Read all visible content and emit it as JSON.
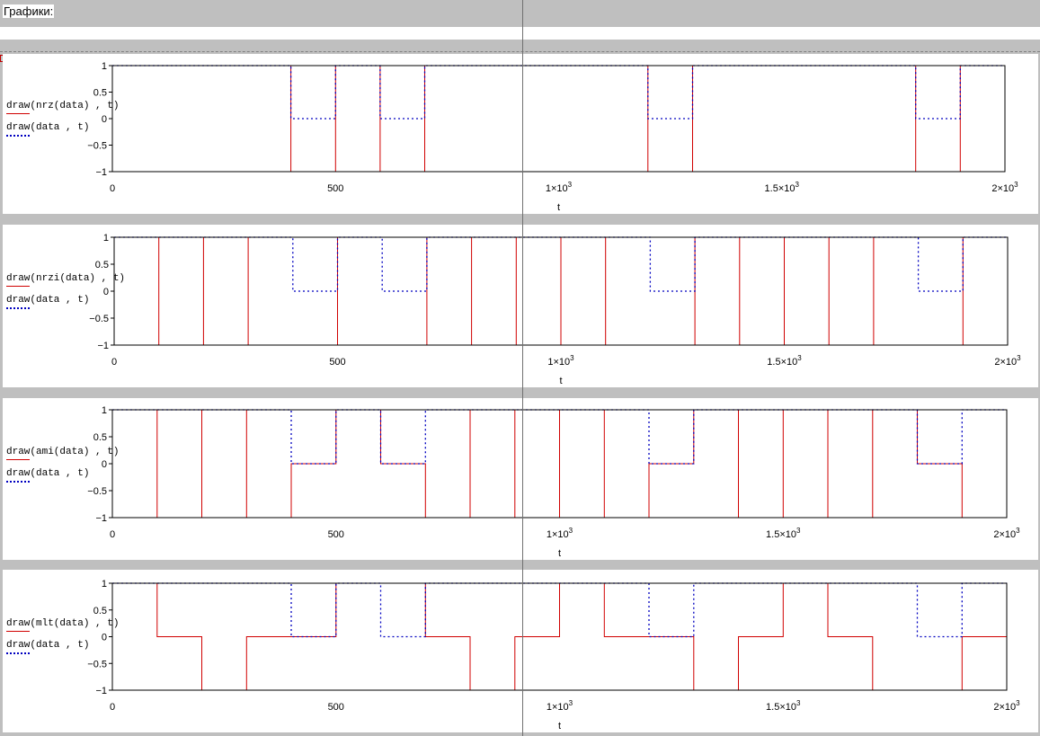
{
  "header": {
    "title": "Графики:"
  },
  "colors": {
    "series_solid": "#d00000",
    "series_dotted": "#0000c0",
    "frame": "#000000"
  },
  "chart_data": [
    {
      "type": "line",
      "xlabel": "t",
      "xlim": [
        0,
        2000
      ],
      "ylim": [
        -1,
        1
      ],
      "x_ticks": [
        "0",
        "500",
        "1×10^3",
        "1.5×10^3",
        "2×10^3"
      ],
      "y_ticks": [
        "1",
        "0.5",
        "0",
        "−0.5",
        "−1"
      ],
      "legend": [
        "draw(nrz(data) , t)",
        "draw(data , t)"
      ],
      "data_bits": [
        1,
        1,
        1,
        1,
        0,
        1,
        0,
        1,
        1,
        1,
        1,
        1,
        0,
        1,
        1,
        1,
        1,
        1,
        0,
        1
      ],
      "series": [
        {
          "name": "draw(nrz(data) , t)",
          "style": "solid",
          "levels": [
            1,
            1,
            1,
            1,
            -1,
            1,
            -1,
            1,
            1,
            1,
            1,
            1,
            -1,
            1,
            1,
            1,
            1,
            1,
            -1,
            1
          ]
        },
        {
          "name": "draw(data , t)",
          "style": "dotted",
          "levels": [
            1,
            1,
            1,
            1,
            0,
            1,
            0,
            1,
            1,
            1,
            1,
            1,
            0,
            1,
            1,
            1,
            1,
            1,
            0,
            1
          ]
        }
      ]
    },
    {
      "type": "line",
      "xlabel": "t",
      "xlim": [
        0,
        2000
      ],
      "ylim": [
        -1,
        1
      ],
      "x_ticks": [
        "0",
        "500",
        "1×10^3",
        "1.5×10^3",
        "2×10^3"
      ],
      "y_ticks": [
        "1",
        "0.5",
        "0",
        "−0.5",
        "−1"
      ],
      "legend": [
        "draw(nrzi(data) , t)",
        "draw(data , t)"
      ],
      "data_bits": [
        1,
        1,
        1,
        1,
        0,
        1,
        0,
        1,
        1,
        1,
        1,
        1,
        0,
        1,
        1,
        1,
        1,
        1,
        0,
        1
      ],
      "series": [
        {
          "name": "draw(nrzi(data) , t)",
          "style": "solid",
          "levels": [
            1,
            -1,
            1,
            -1,
            -1,
            1,
            1,
            -1,
            1,
            -1,
            1,
            -1,
            -1,
            1,
            -1,
            1,
            -1,
            1,
            1,
            -1
          ]
        },
        {
          "name": "draw(data , t)",
          "style": "dotted",
          "levels": [
            1,
            1,
            1,
            1,
            0,
            1,
            0,
            1,
            1,
            1,
            1,
            1,
            0,
            1,
            1,
            1,
            1,
            1,
            0,
            1
          ]
        }
      ]
    },
    {
      "type": "line",
      "xlabel": "t",
      "xlim": [
        0,
        2000
      ],
      "ylim": [
        -1,
        1
      ],
      "x_ticks": [
        "0",
        "500",
        "1×10^3",
        "1.5×10^3",
        "2×10^3"
      ],
      "y_ticks": [
        "1",
        "0.5",
        "0",
        "−0.5",
        "−1"
      ],
      "legend": [
        "draw(ami(data) , t)",
        "draw(data , t)"
      ],
      "data_bits": [
        1,
        1,
        1,
        1,
        0,
        1,
        0,
        1,
        1,
        1,
        1,
        1,
        0,
        1,
        1,
        1,
        1,
        1,
        0,
        1
      ],
      "series": [
        {
          "name": "draw(ami(data) , t)",
          "style": "solid",
          "levels": [
            1,
            -1,
            1,
            -1,
            0,
            1,
            0,
            -1,
            1,
            -1,
            1,
            -1,
            0,
            1,
            -1,
            1,
            -1,
            1,
            0,
            -1
          ]
        },
        {
          "name": "draw(data , t)",
          "style": "dotted",
          "levels": [
            1,
            1,
            1,
            1,
            0,
            1,
            0,
            1,
            1,
            1,
            1,
            1,
            0,
            1,
            1,
            1,
            1,
            1,
            0,
            1
          ]
        }
      ]
    },
    {
      "type": "line",
      "xlabel": "t",
      "xlim": [
        0,
        2000
      ],
      "ylim": [
        -1,
        1
      ],
      "x_ticks": [
        "0",
        "500",
        "1×10^3",
        "1.5×10^3",
        "2×10^3"
      ],
      "y_ticks": [
        "1",
        "0.5",
        "0",
        "−0.5",
        "−1"
      ],
      "legend": [
        "draw(mlt(data) , t)",
        "draw(data , t)"
      ],
      "data_bits": [
        1,
        1,
        1,
        1,
        0,
        1,
        0,
        1,
        1,
        1,
        1,
        1,
        0,
        1,
        1,
        1,
        1,
        1,
        0,
        1
      ],
      "series": [
        {
          "name": "draw(mlt(data) , t)",
          "style": "solid",
          "levels": [
            1,
            0,
            -1,
            0,
            0,
            1,
            1,
            0,
            -1,
            0,
            1,
            0,
            0,
            -1,
            0,
            1,
            0,
            -1,
            -1,
            0
          ]
        },
        {
          "name": "draw(data , t)",
          "style": "dotted",
          "levels": [
            1,
            1,
            1,
            1,
            0,
            1,
            0,
            1,
            1,
            1,
            1,
            1,
            0,
            1,
            1,
            1,
            1,
            1,
            0,
            1
          ]
        }
      ]
    }
  ]
}
